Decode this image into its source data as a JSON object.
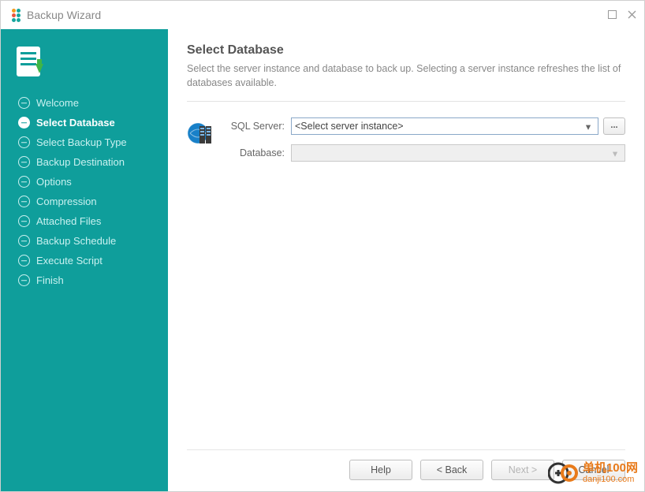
{
  "titlebar": {
    "title": "Backup Wizard"
  },
  "sidebar": {
    "items": [
      {
        "label": "Welcome"
      },
      {
        "label": "Select Database"
      },
      {
        "label": "Select Backup Type"
      },
      {
        "label": "Backup Destination"
      },
      {
        "label": "Options"
      },
      {
        "label": "Compression"
      },
      {
        "label": "Attached Files"
      },
      {
        "label": "Backup Schedule"
      },
      {
        "label": "Execute Script"
      },
      {
        "label": "Finish"
      }
    ],
    "active_index": 1
  },
  "content": {
    "heading": "Select Database",
    "subtitle": "Select the server instance and database to back up. Selecting a server instance refreshes the list of databases available.",
    "fields": {
      "sql_server_label": "SQL Server:",
      "sql_server_value": "<Select server instance>",
      "database_label": "Database:",
      "database_value": "",
      "browse_label": "..."
    }
  },
  "footer": {
    "help": "Help",
    "back": "< Back",
    "next": "Next >",
    "cancel": "Cancel"
  },
  "watermark": {
    "line1": "单机100网",
    "line2": "danji100.com"
  }
}
